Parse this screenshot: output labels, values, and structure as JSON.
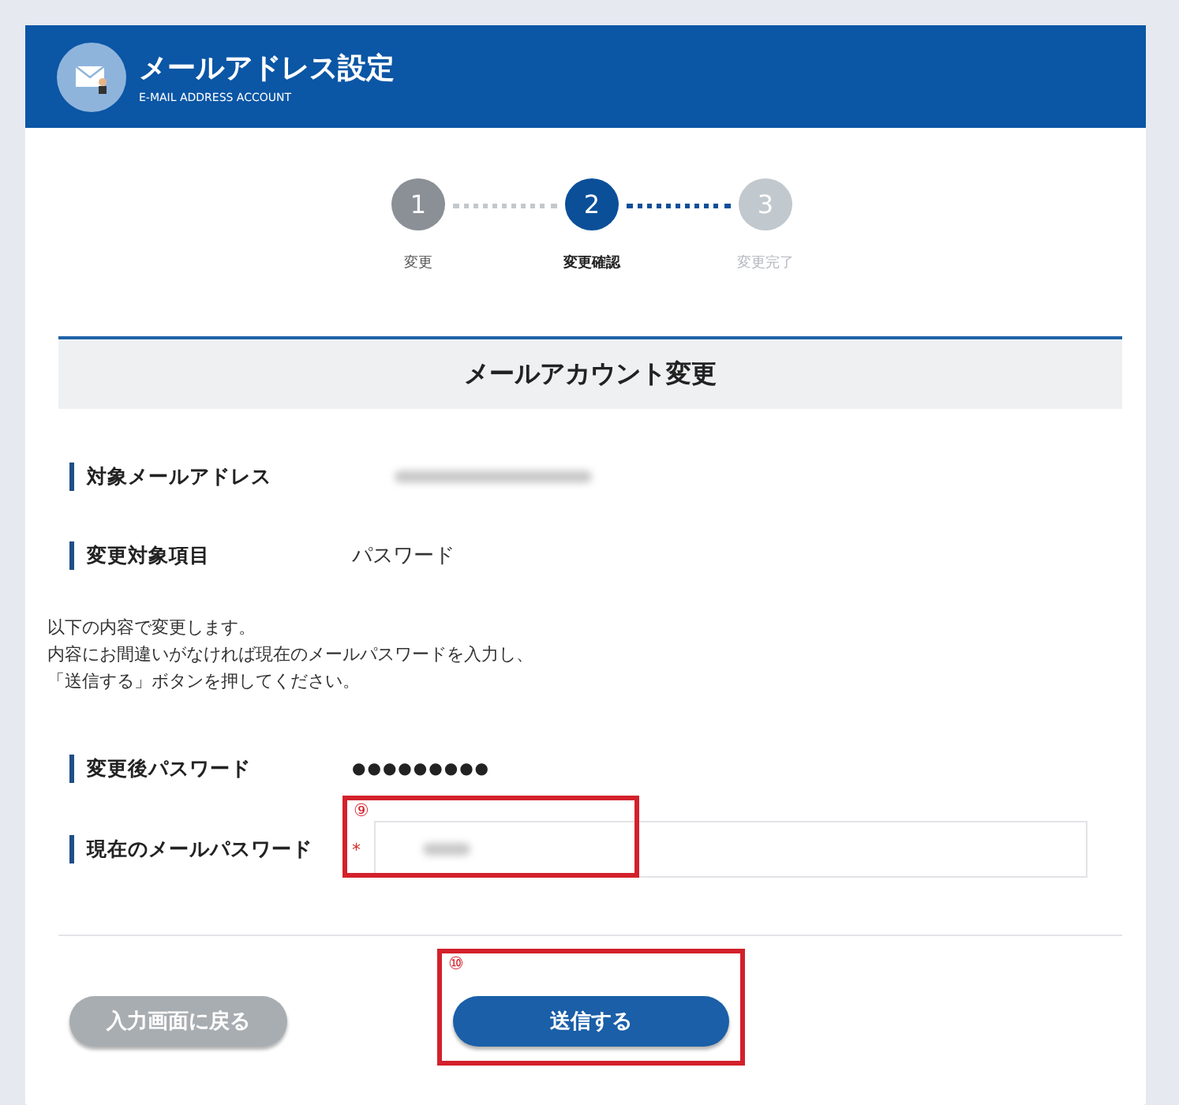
{
  "header": {
    "title": "メールアドレス設定",
    "subtitle": "E-MAIL ADDRESS ACCOUNT"
  },
  "steps": [
    {
      "number": "1",
      "label": "変更",
      "selected": false,
      "completed": true
    },
    {
      "number": "2",
      "label": "変更確認",
      "selected": true,
      "completed": false
    },
    {
      "number": "3",
      "label": "変更完了",
      "selected": false,
      "completed": false
    }
  ],
  "section_title": "メールアカウント変更",
  "fields": [
    {
      "label": "対象メールアドレス",
      "kind": "redacted"
    },
    {
      "label": "変更対象項目",
      "kind": "text",
      "value": "パスワード"
    }
  ],
  "instructions": [
    "以下の内容で変更します。",
    "内容にお間違いがなければ現在のメールパスワードを入力し、",
    "「送信する」ボタンを押してください。"
  ],
  "fields_after": [
    {
      "label": "変更後パスワード",
      "kind": "text",
      "value": "●●●●●●●●●"
    },
    {
      "label": "現在のメールパスワード",
      "kind": "input",
      "required_mark": "*",
      "annotation": "⑨"
    }
  ],
  "buttons": [
    {
      "label": "入力画面に戻る",
      "kind": "secondary"
    },
    {
      "label": "送信する",
      "kind": "primary",
      "annotation": "⑩"
    }
  ]
}
